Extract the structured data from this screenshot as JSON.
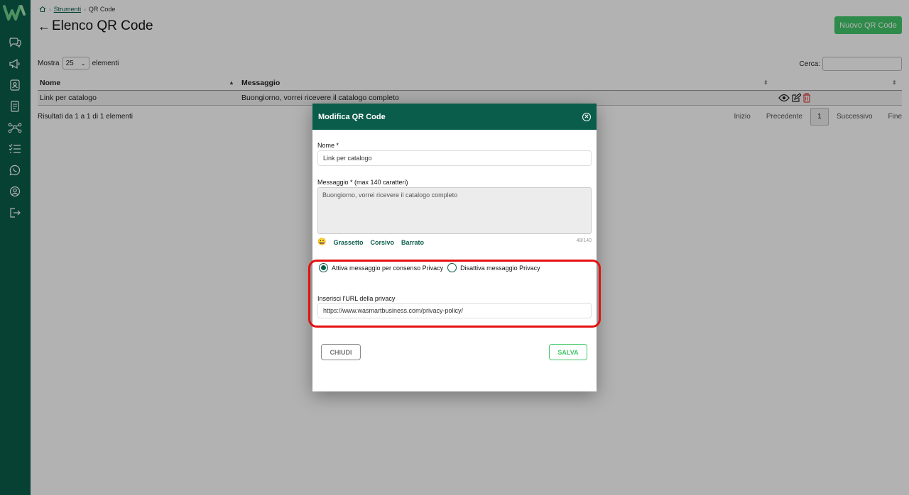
{
  "breadcrumb": {
    "home_icon": "home-icon",
    "parent": "Strumenti",
    "current": "QR Code"
  },
  "page": {
    "title": "Elenco QR Code",
    "new_button": "Nuovo QR Code"
  },
  "table_controls": {
    "show_label": "Mostra",
    "page_size": "25",
    "items_label": "elementi",
    "search_label": "Cerca:"
  },
  "table": {
    "headers": {
      "nome": "Nome",
      "messaggio": "Messaggio"
    },
    "rows": [
      {
        "nome": "Link per catalogo",
        "messaggio": "Buongiorno, vorrei ricevere il catalogo completo"
      }
    ],
    "results_text": "Risultati da 1 a 1 di 1 elementi"
  },
  "pagination": {
    "first": "Inizio",
    "prev": "Precedente",
    "current": "1",
    "next": "Successivo",
    "last": "Fine"
  },
  "modal": {
    "title": "Modifica QR Code",
    "name_label": "Nome *",
    "name_value": "Link per catalogo",
    "message_label": "Messaggio * (max 140 caratteri)",
    "message_value": "Buongiorno, vorrei ricevere il catalogo completo",
    "format": {
      "bold": "Grassetto",
      "italic": "Corsivo",
      "strike": "Barrato"
    },
    "counter": "48/140",
    "privacy_on": "Attiva messaggio per consenso Privacy",
    "privacy_off": "Disattiva messaggio Privacy",
    "privacy_on_selected": true,
    "privacy_url_label": "Inserisci l'URL della privacy",
    "privacy_url_value": "https://www.wasmartbusiness.com/privacy-policy/",
    "close_button": "CHIUDI",
    "save_button": "SALVA"
  },
  "colors": {
    "brand": "#0b5d4b",
    "accent": "#43c86a",
    "highlight": "#e51010",
    "delete": "#e04a4a"
  },
  "sidebar_icons": [
    "chat-icon",
    "megaphone-icon",
    "contacts-icon",
    "document-icon",
    "workflow-icon",
    "checklist-icon",
    "whatsapp-icon",
    "user-icon",
    "logout-icon"
  ]
}
